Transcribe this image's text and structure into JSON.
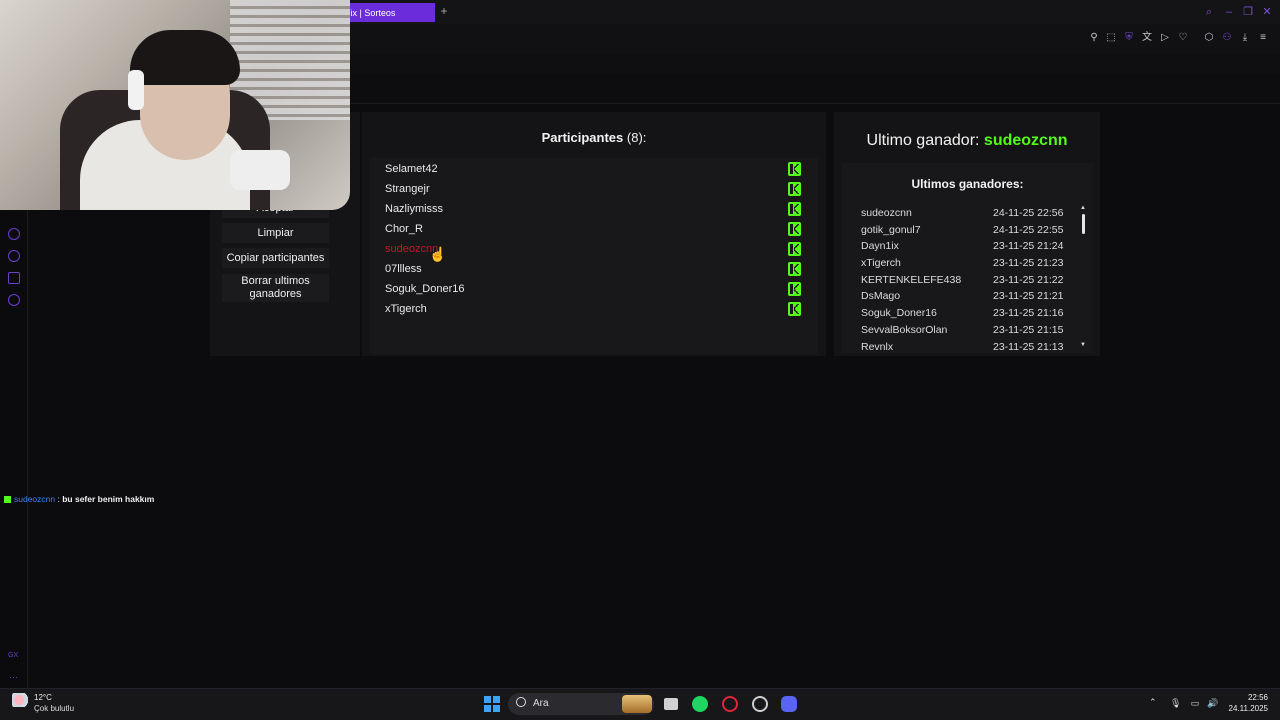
{
  "browser": {
    "active_tab_label": "Rix | Sorteos",
    "new_tab_symbol": "+"
  },
  "sidebar": {
    "gx_label": "GX",
    "more_symbol": "···"
  },
  "controls": {
    "accept_label": "Aceptar",
    "clear_label": "Limpiar",
    "copy_label": "Copiar participantes",
    "delete_winners_label": "Borrar ultimos ganadores"
  },
  "participants": {
    "title": "Participantes",
    "count": "(8):",
    "items": [
      {
        "name": "Selamet42",
        "highlighted": false
      },
      {
        "name": "Strangejr",
        "highlighted": false
      },
      {
        "name": "Nazliymisss",
        "highlighted": false
      },
      {
        "name": "Chor_R",
        "highlighted": false
      },
      {
        "name": "sudeozcnn",
        "highlighted": true
      },
      {
        "name": "07llless",
        "highlighted": false
      },
      {
        "name": "Soguk_Doner16",
        "highlighted": false
      },
      {
        "name": "xTigerch",
        "highlighted": false
      }
    ],
    "platform_icon": "kick-icon"
  },
  "winners": {
    "last_winner_label": "Ultimo ganador:",
    "last_winner_name": "sudeozcnn",
    "list_title": "Ultimos ganadores:",
    "rows": [
      {
        "name": "sudeozcnn",
        "date": "24-11-25 22:56"
      },
      {
        "name": "gotik_gonul7",
        "date": "24-11-25 22:55"
      },
      {
        "name": "Dayn1ix",
        "date": "23-11-25 21:24"
      },
      {
        "name": "xTigerch",
        "date": "23-11-25 21:23"
      },
      {
        "name": "KERTENKELEFE438",
        "date": "23-11-25 21:22"
      },
      {
        "name": "DsMago",
        "date": "23-11-25 21:21"
      },
      {
        "name": "Soguk_Doner16",
        "date": "23-11-25 21:16"
      },
      {
        "name": "SevvalBoksorOlan",
        "date": "23-11-25 21:15"
      },
      {
        "name": "Revnlx",
        "date": "23-11-25 21:13"
      }
    ]
  },
  "chat": {
    "user": "sudeozcnn",
    "separator": " : ",
    "message": "bu sefer benim hakkım"
  },
  "taskbar": {
    "weather_temp": "12°C",
    "weather_desc": "Çok bulutlu",
    "search_label": "Ara",
    "time": "22:56",
    "date": "24.11.2025"
  },
  "colors": {
    "accent": "#6b2cdb",
    "kick_green": "#53fc18",
    "highlight_red": "#c21826",
    "panel": "#141416"
  }
}
